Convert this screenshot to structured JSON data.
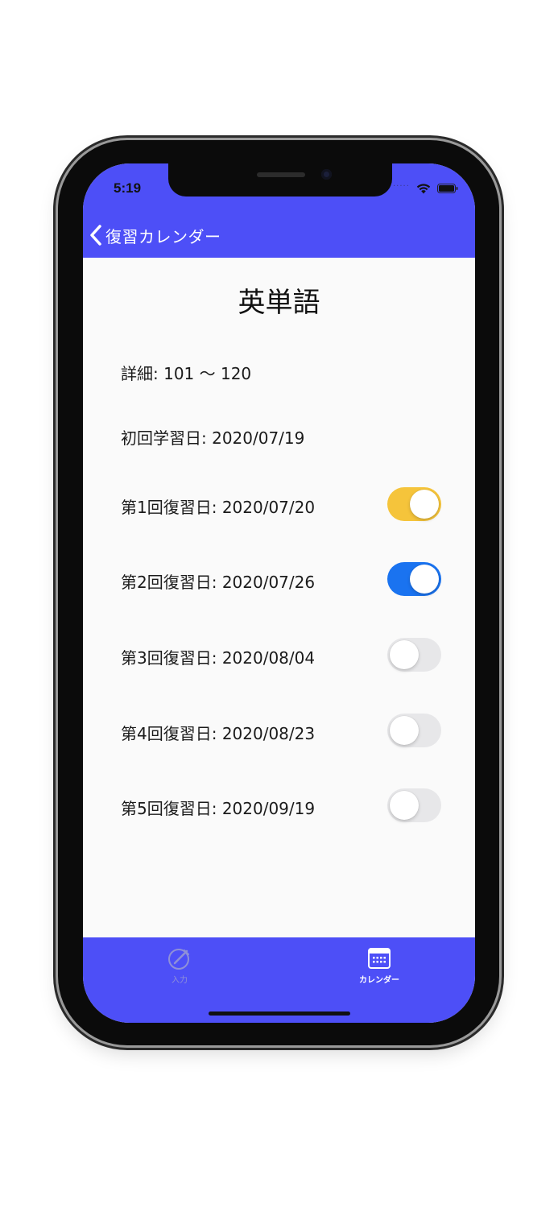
{
  "status_bar": {
    "time": "5:19",
    "signal_dots": "....."
  },
  "nav": {
    "back_label": "復習カレンダー"
  },
  "main": {
    "title": "英単語",
    "detail": "詳細: 101 〜 120",
    "first_study": "初回学習日: 2020/07/19",
    "reviews": [
      {
        "label": "第1回復習日: 2020/07/20",
        "on": true,
        "color": "#f5c43b"
      },
      {
        "label": "第2回復習日: 2020/07/26",
        "on": true,
        "color": "#1a73f0"
      },
      {
        "label": "第3回復習日: 2020/08/04",
        "on": false,
        "color": "#e7e7e9"
      },
      {
        "label": "第4回復習日: 2020/08/23",
        "on": false,
        "color": "#e7e7e9"
      },
      {
        "label": "第5回復習日: 2020/09/19",
        "on": false,
        "color": "#e7e7e9"
      }
    ]
  },
  "tab_bar": {
    "tabs": [
      {
        "label": "入力",
        "icon": "pencil-circle-icon",
        "selected": false
      },
      {
        "label": "カレンダー",
        "icon": "calendar-icon",
        "selected": true
      }
    ]
  },
  "colors": {
    "accent": "#4d4ff7"
  }
}
